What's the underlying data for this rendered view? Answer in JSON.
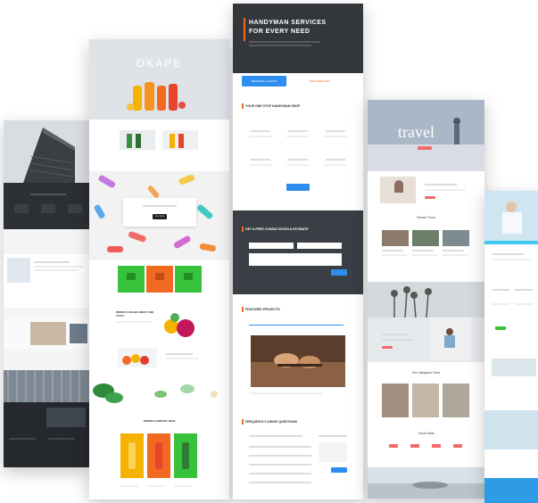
{
  "okape": {
    "logo": "OKAPE",
    "featured_button": "BUY NOW",
    "section_heading": "DRINKS CAN BE GREAT AND TASTY",
    "bottom_heading": "DRINKS COMPANY NOW"
  },
  "handyman": {
    "hero_title_line1": "HANDYMAN SERVICES",
    "hero_title_line2": "FOR EVERY NEED",
    "hero_btn_primary": "REQUEST A QUOTE",
    "hero_btn_secondary": "VIEW SERVICES",
    "section_services": "YOUR ONE STOP HANDYMAN SHOP",
    "section_consult": "GET A FREE CONSULTATION & ESTIMATE",
    "section_projects": "FEATURED PROJECTS",
    "section_faq": "FREQUENTLY ASKED QUESTIONS"
  },
  "travel": {
    "hero_title": "travel",
    "section_tours": "Recent Tours",
    "section_explore": "Explore Ideas",
    "section_instagram": "Our Instagram Feed",
    "section_stats": "Travel Stats"
  },
  "colors": {
    "orange": "#f26a21",
    "green": "#37c23c",
    "yellow": "#f6b200",
    "blue": "#2e8ef0",
    "dark": "#303438"
  }
}
